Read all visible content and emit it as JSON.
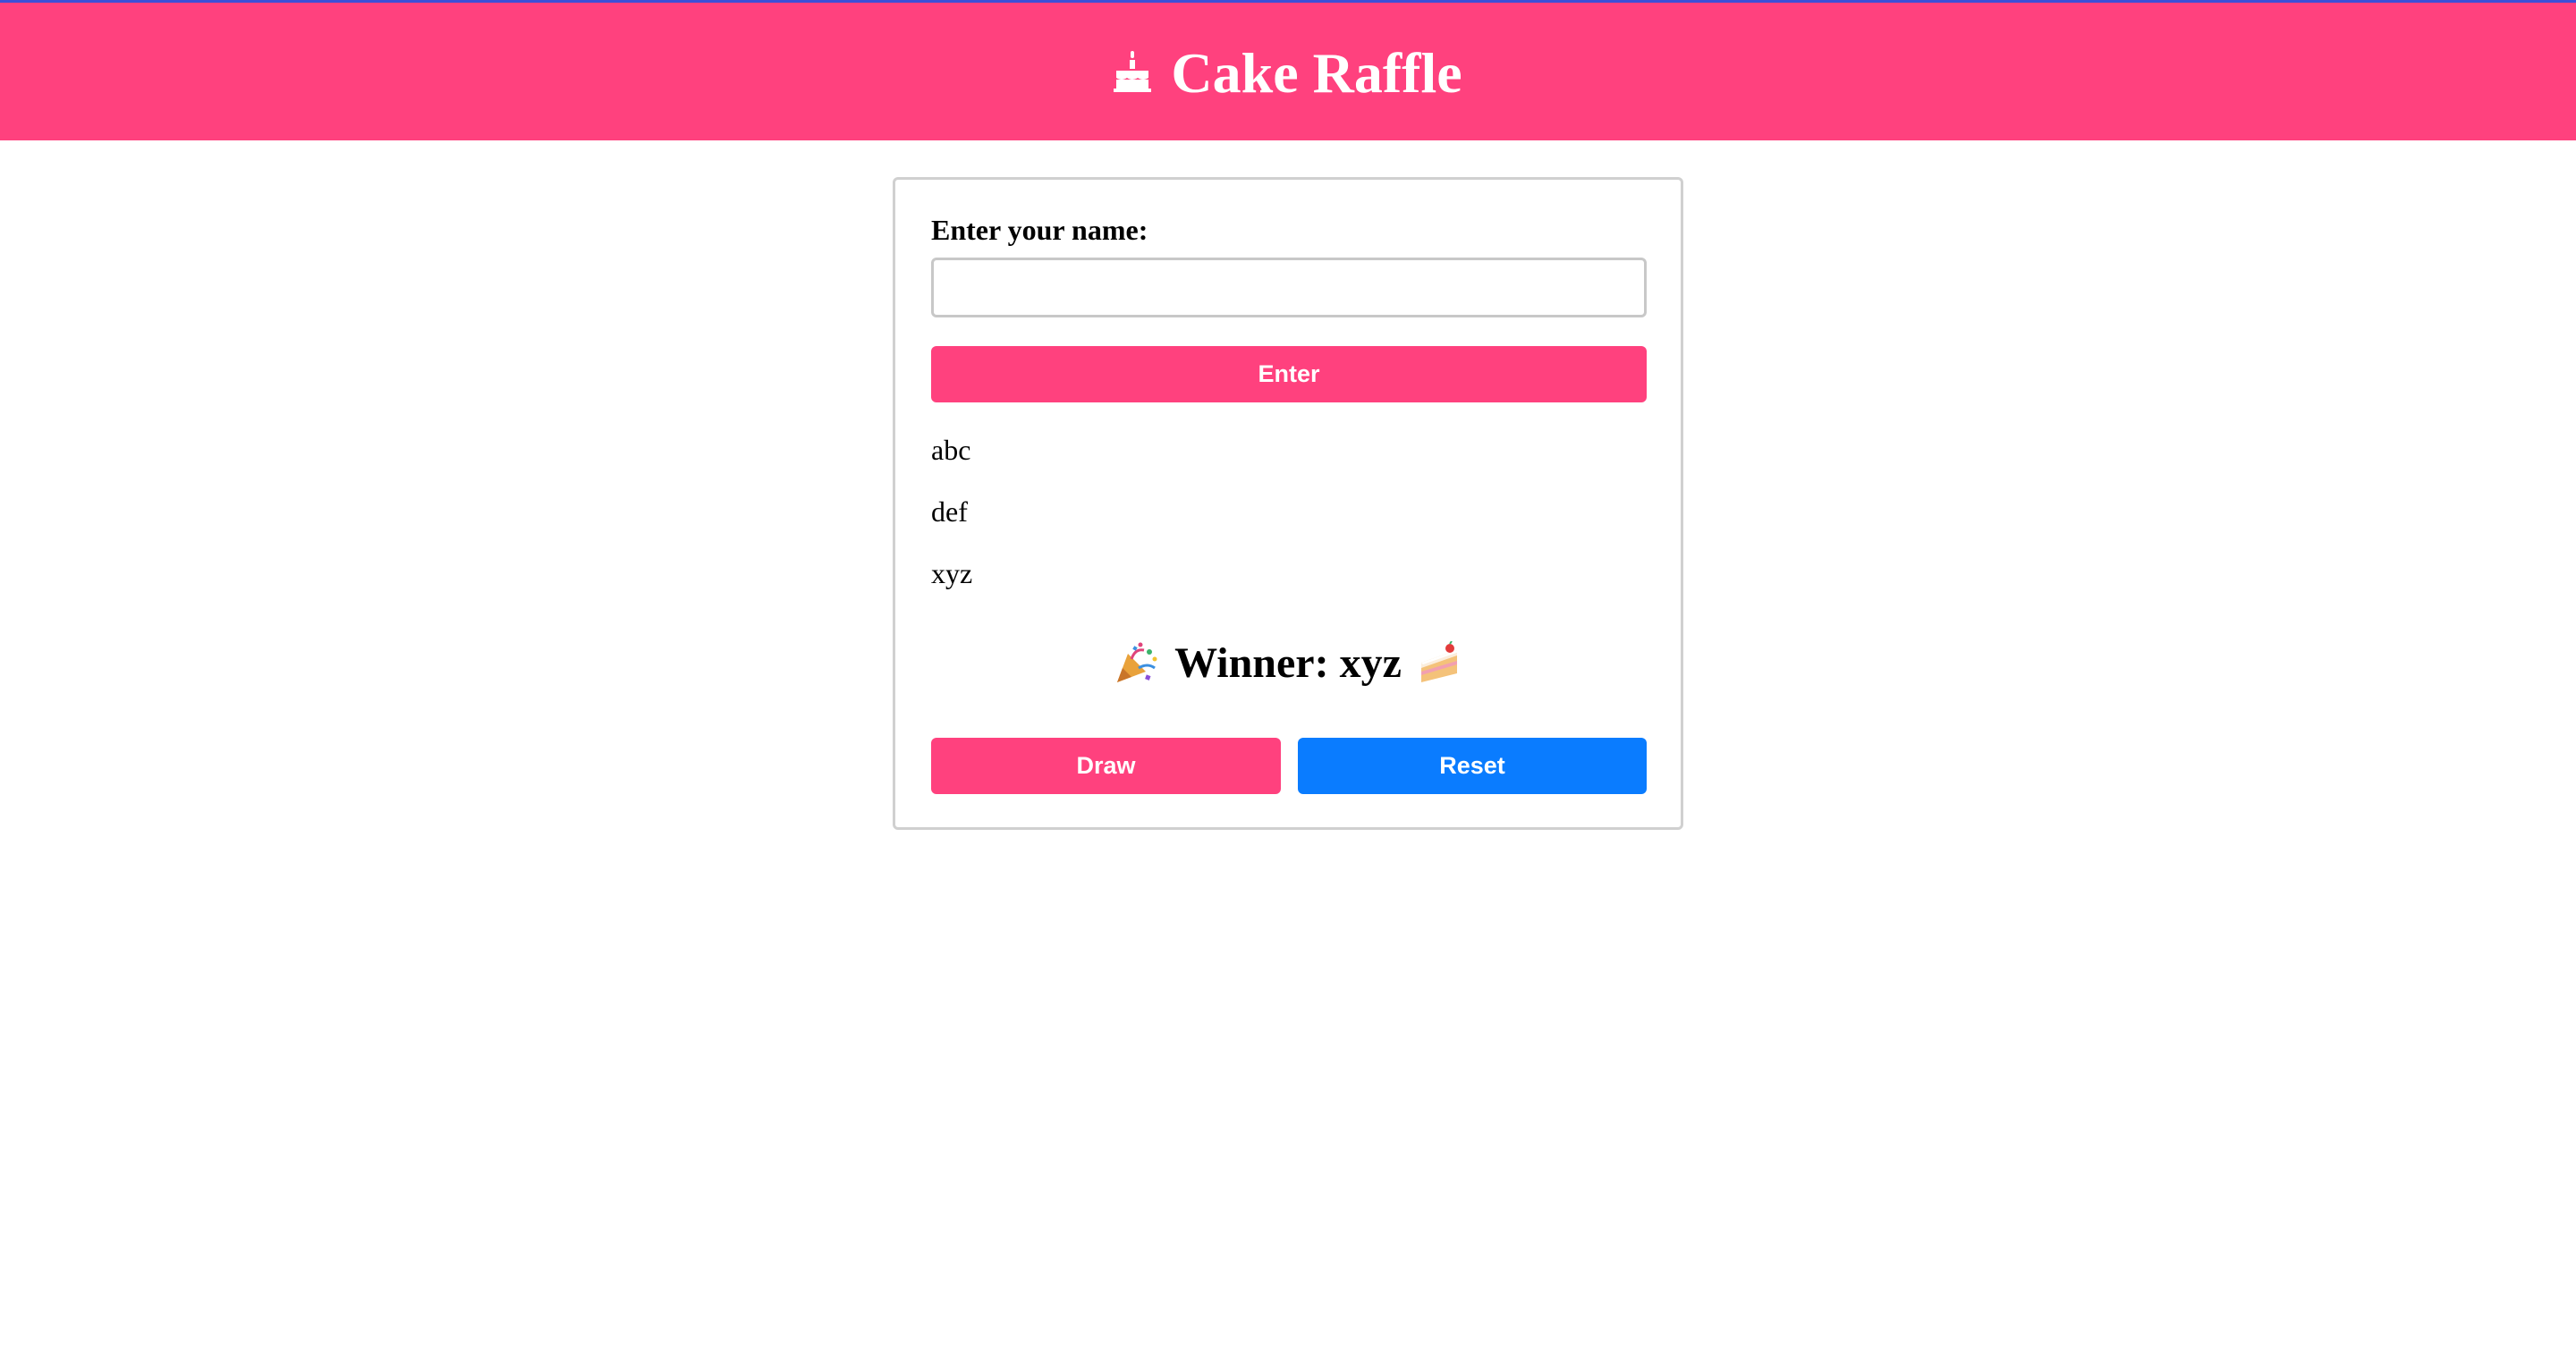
{
  "header": {
    "title": "Cake Raffle",
    "icon": "birthday-cake-icon",
    "background_color": "#ff417e"
  },
  "form": {
    "name_label": "Enter your name:",
    "name_input_value": "",
    "name_input_placeholder": "",
    "enter_button_label": "Enter"
  },
  "entries": [
    "abc",
    "def",
    "xyz"
  ],
  "winner": {
    "text": "Winner: xyz",
    "leading_icon": "party-popper-icon",
    "trailing_icon": "shortcake-icon"
  },
  "actions": {
    "draw_label": "Draw",
    "reset_label": "Reset",
    "draw_color": "#ff417e",
    "reset_color": "#0a7cff"
  }
}
